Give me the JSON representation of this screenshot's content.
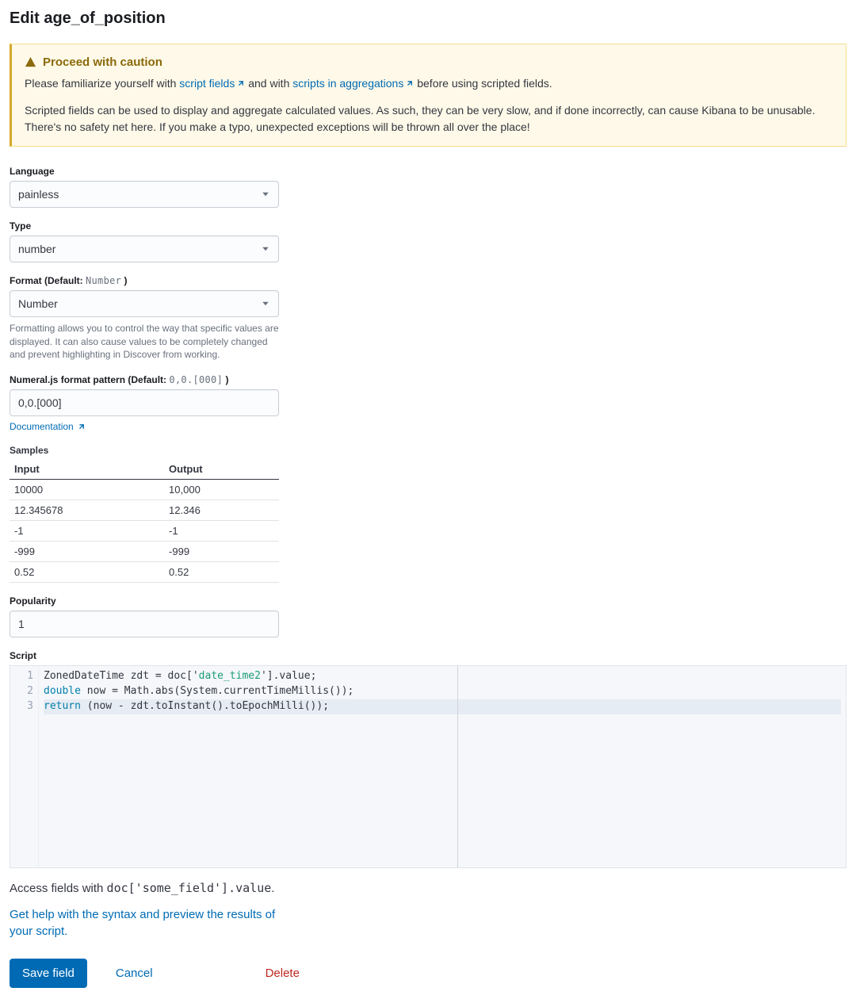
{
  "title": "Edit age_of_position",
  "callout": {
    "heading": "Proceed with caution",
    "p1_pre": "Please familiarize yourself with ",
    "link1": "script fields",
    "p1_mid": " and with ",
    "link2": "scripts in aggregations",
    "p1_post": " before using scripted fields.",
    "p2": "Scripted fields can be used to display and aggregate calculated values. As such, they can be very slow, and if done incorrectly, can cause Kibana to be unusable. There's no safety net here. If you make a typo, unexpected exceptions will be thrown all over the place!"
  },
  "language": {
    "label": "Language",
    "value": "painless"
  },
  "type": {
    "label": "Type",
    "value": "number"
  },
  "format": {
    "label_pre": "Format (Default: ",
    "label_default": "Number",
    "label_post": " )",
    "value": "Number",
    "help": "Formatting allows you to control the way that specific values are displayed. It can also cause values to be completely changed and prevent highlighting in Discover from working."
  },
  "numeral": {
    "label_pre": "Numeral.js format pattern (Default: ",
    "label_default": "0,0.[000]",
    "label_post": " )",
    "value": "0,0.[000]",
    "doc_link": "Documentation"
  },
  "samples": {
    "label": "Samples",
    "headers": {
      "input": "Input",
      "output": "Output"
    },
    "rows": [
      {
        "input": "10000",
        "output": "10,000"
      },
      {
        "input": "12.345678",
        "output": "12.346"
      },
      {
        "input": "-1",
        "output": "-1"
      },
      {
        "input": "-999",
        "output": "-999"
      },
      {
        "input": "0.52",
        "output": "0.52"
      }
    ]
  },
  "popularity": {
    "label": "Popularity",
    "value": "1"
  },
  "script": {
    "label": "Script",
    "line1": {
      "pre": "ZonedDateTime zdt = doc['",
      "str": "date_time2",
      "post": "'].value;"
    },
    "line2": {
      "kw": "double",
      "rest": " now = Math.abs(System.currentTimeMillis());"
    },
    "line3": {
      "kw": "return",
      "rest": " (now - zdt.toInstant().toEpochMilli());"
    }
  },
  "access_hint": {
    "pre": "Access fields with ",
    "code": "doc['some_field'].value",
    "post": "."
  },
  "syntax_help": "Get help with the syntax and preview the results of your script.",
  "buttons": {
    "save": "Save field",
    "cancel": "Cancel",
    "delete": "Delete"
  }
}
